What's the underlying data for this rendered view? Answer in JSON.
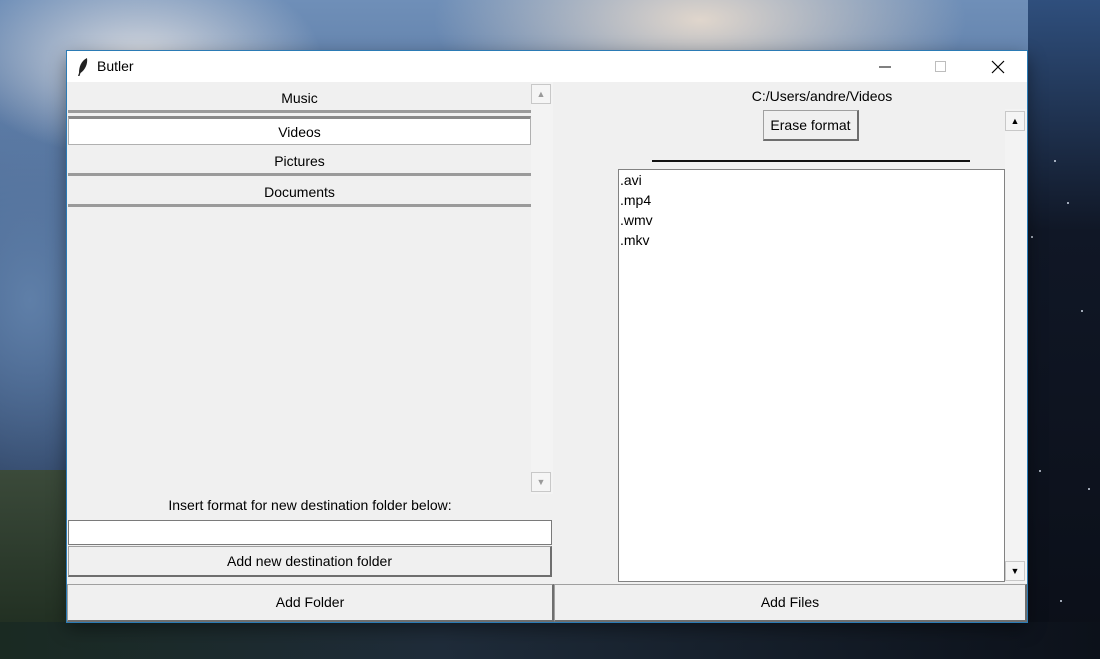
{
  "window": {
    "title": "Butler"
  },
  "folders": [
    {
      "label": "Music"
    },
    {
      "label": "Videos"
    },
    {
      "label": "Pictures"
    },
    {
      "label": "Documents"
    }
  ],
  "selected_folder": "Videos",
  "left_panel": {
    "format_label": "Insert format for new destination folder below:",
    "format_input_value": "",
    "add_destination_label": "Add new destination folder"
  },
  "right_panel": {
    "path": "C:/Users/andre/Videos",
    "erase_label": "Erase format",
    "formats": [
      ".avi",
      ".mp4",
      ".wmv",
      ".mkv"
    ]
  },
  "bottom": {
    "add_folder_label": "Add Folder",
    "add_files_label": "Add Files"
  },
  "icons": {
    "app": "feather-icon",
    "minimize": "minimize-icon",
    "maximize": "maximize-icon",
    "close": "close-icon",
    "scroll_up": "scroll-up-arrow-icon",
    "scroll_down": "scroll-down-arrow-icon"
  },
  "colors": {
    "window_border": "#2b7bb5",
    "panel_bg": "#f0f0f0"
  }
}
